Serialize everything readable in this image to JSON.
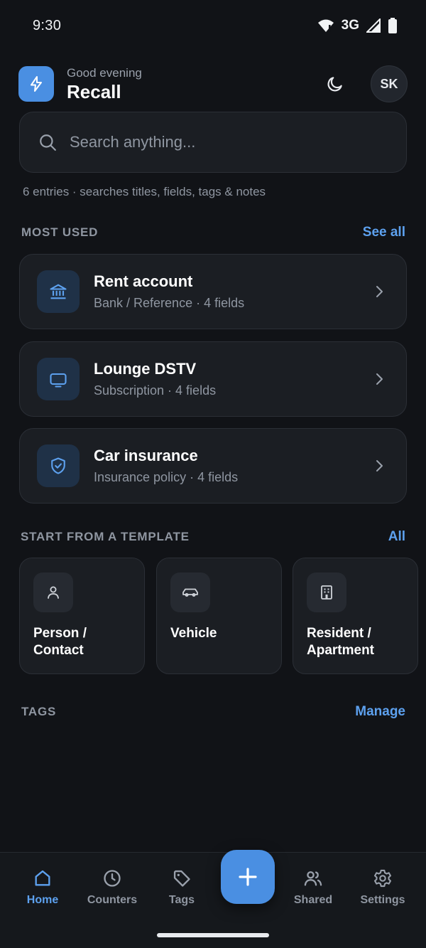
{
  "status_bar": {
    "time": "9:30",
    "network": "3G"
  },
  "header": {
    "greeting": "Good evening",
    "title": "Recall",
    "avatar_initials": "SK"
  },
  "search": {
    "placeholder": "Search anything...",
    "hint": "6 entries · searches titles, fields, tags & notes"
  },
  "most_used": {
    "title": "MOST USED",
    "link": "See all",
    "items": [
      {
        "title": "Rent account",
        "subtitle": "Bank / Reference · 4 fields",
        "icon": "bank-icon"
      },
      {
        "title": "Lounge DSTV",
        "subtitle": "Subscription · 4 fields",
        "icon": "tv-icon"
      },
      {
        "title": "Car insurance",
        "subtitle": "Insurance policy · 4 fields",
        "icon": "shield-check-icon"
      }
    ]
  },
  "templates": {
    "title": "START FROM A TEMPLATE",
    "link": "All",
    "items": [
      {
        "label": "Person /\nContact",
        "icon": "person-icon"
      },
      {
        "label": "Vehicle",
        "icon": "car-icon"
      },
      {
        "label": "Resident /\nApartment",
        "icon": "building-icon"
      }
    ]
  },
  "tags": {
    "title": "TAGS",
    "link": "Manage"
  },
  "bottom_nav": {
    "items": [
      {
        "label": "Home",
        "icon": "home-icon",
        "active": true
      },
      {
        "label": "Counters",
        "icon": "clock-icon"
      },
      {
        "label": "Tags",
        "icon": "tag-icon"
      },
      {
        "label": "Shared",
        "icon": "users-icon"
      },
      {
        "label": "Settings",
        "icon": "gear-icon"
      }
    ],
    "fab_icon": "plus-icon"
  },
  "colors": {
    "accent": "#4a8fe2",
    "link": "#5da1ef",
    "background": "#111317",
    "card": "#1b1e23"
  }
}
